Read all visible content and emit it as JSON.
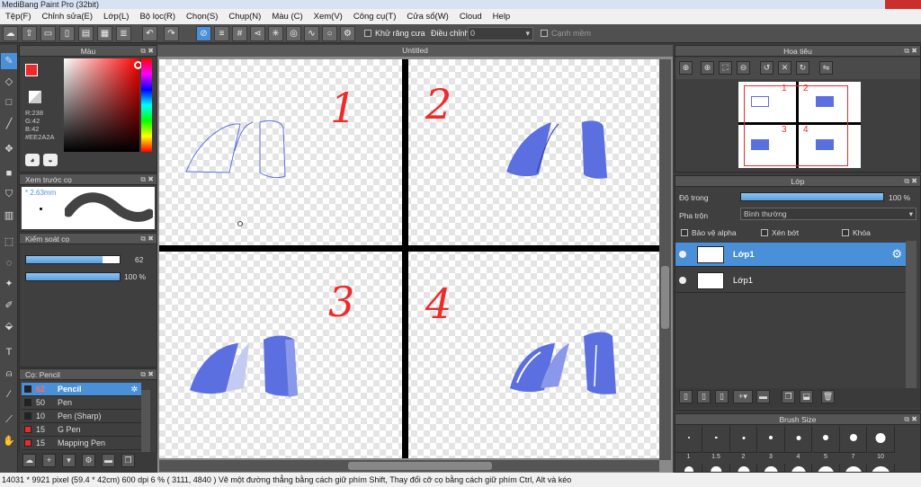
{
  "window": {
    "title": "MediBang Paint Pro (32bit)"
  },
  "menu": [
    "Tệp(F)",
    "Chỉnh sửa(E)",
    "Lớp(L)",
    "Bộ lọc(R)",
    "Chọn(S)",
    "Chụp(N)",
    "Màu (C)",
    "Xem(V)",
    "Công cụ(T)",
    "Cửa sổ(W)",
    "Cloud",
    "Help"
  ],
  "toolbar": {
    "antialias_label": "Khử răng cưa",
    "correction_label": "Điều chỉnh",
    "correction_value": "0",
    "snap_label": "Cạnh mềm"
  },
  "color_panel": {
    "title": "Màu",
    "r": "R:238",
    "g": "G:42",
    "b": "B:42",
    "hex": "#EE2A2A",
    "primary_color": "#EE2A2A"
  },
  "brush_preview": {
    "title": "Xem trước cọ",
    "size": "2.63mm"
  },
  "brush_control": {
    "title": "Kiểm soát cọ",
    "size_value": "62",
    "size_fill": 0.82,
    "opacity_value": "100 %",
    "opacity_fill": 1.0
  },
  "brush_list": {
    "title": "Cọ: Pencil",
    "items": [
      {
        "size": "62",
        "name": "Pencil",
        "color": "#222222",
        "selected": true
      },
      {
        "size": "50",
        "name": "Pen",
        "color": "#222222",
        "selected": false
      },
      {
        "size": "10",
        "name": "Pen (Sharp)",
        "color": "#222222",
        "selected": false
      },
      {
        "size": "15",
        "name": "G Pen",
        "color": "#EE2A2A",
        "selected": false
      },
      {
        "size": "15",
        "name": "Mapping Pen",
        "color": "#EE2A2A",
        "selected": false
      }
    ]
  },
  "canvas": {
    "tab_title": "Untitled",
    "numbers": [
      "1",
      "2",
      "3",
      "4"
    ],
    "stroke_color": "#EE2A2A",
    "fill_color": "#5B6FE0"
  },
  "navigator": {
    "title": "Hoa tiêu",
    "numbers": [
      "1",
      "2",
      "3",
      "4"
    ]
  },
  "layer_panel": {
    "title": "Lớp",
    "opacity_label": "Độ trong",
    "opacity_value": "100 %",
    "opacity_fill": 1.0,
    "blend_label": "Pha trộn",
    "blend_value": "Bình thường",
    "protect_alpha": "Bảo vệ alpha",
    "clipping": "Xén bớt",
    "lock": "Khóa",
    "layers": [
      {
        "name": "Lớp1",
        "selected": true
      },
      {
        "name": "Lớp1",
        "selected": false
      }
    ]
  },
  "brush_size_panel": {
    "title": "Brush Size",
    "labels": [
      "1",
      "1.5",
      "2",
      "3",
      "4",
      "5",
      "7",
      "10"
    ]
  },
  "status": {
    "text": "14031 * 9921 pixel   (59.4 * 42cm)   600 dpi   6 %   ( 3111, 4840 )   Vẽ một đường thẳng bằng cách giữ phím Shift, Thay đổi cỡ cọ bằng cách giữ phím Ctrl, Alt và kéo"
  }
}
